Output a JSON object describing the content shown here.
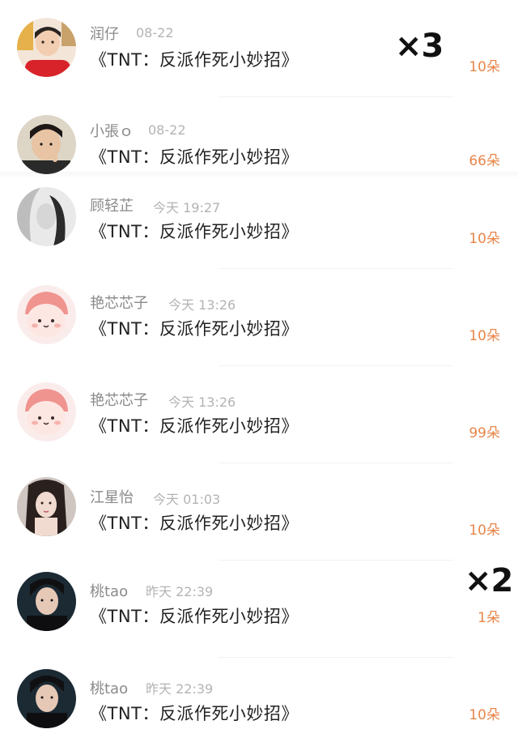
{
  "colors": {
    "accent": "#e8864a",
    "name_gray": "#8a8a8a",
    "time_gray": "#b3b3b3",
    "title": "#222222"
  },
  "items": [
    {
      "user": "润仔",
      "time": "08-22",
      "title": "《TNT：反派作死小妙招》",
      "gift": "10朵",
      "avatar": "avatar-child-red"
    },
    {
      "user": "小張ｏ",
      "time": "08-22",
      "title": "《TNT：反派作死小妙招》",
      "gift": "66朵",
      "avatar": "avatar-child-peace"
    },
    {
      "user": "顾轻芷",
      "time": "今天 19:27",
      "title": "《TNT：反派作死小妙招》",
      "gift": "10朵",
      "avatar": "avatar-woman-bw"
    },
    {
      "user": "艳芯芯子",
      "time": "今天 13:26",
      "title": "《TNT：反派作死小妙招》",
      "gift": "10朵",
      "avatar": "avatar-pink-cartoon"
    },
    {
      "user": "艳芯芯子",
      "time": "今天 13:26",
      "title": "《TNT：反派作死小妙招》",
      "gift": "99朵",
      "avatar": "avatar-pink-cartoon"
    },
    {
      "user": "江星怡",
      "time": "今天 01:03",
      "title": "《TNT：反派作死小妙招》",
      "gift": "10朵",
      "avatar": "avatar-girl-portrait"
    },
    {
      "user": "桃tao",
      "time": "昨天 22:39",
      "title": "《TNT：反派作死小妙招》",
      "gift": "1朵",
      "avatar": "avatar-boy-dark"
    },
    {
      "user": "桃tao",
      "time": "昨天 22:39",
      "title": "《TNT：反派作死小妙招》",
      "gift": "10朵",
      "avatar": "avatar-boy-dark"
    }
  ],
  "overlays": {
    "mult_first": "×3",
    "mult_second": "×2"
  }
}
